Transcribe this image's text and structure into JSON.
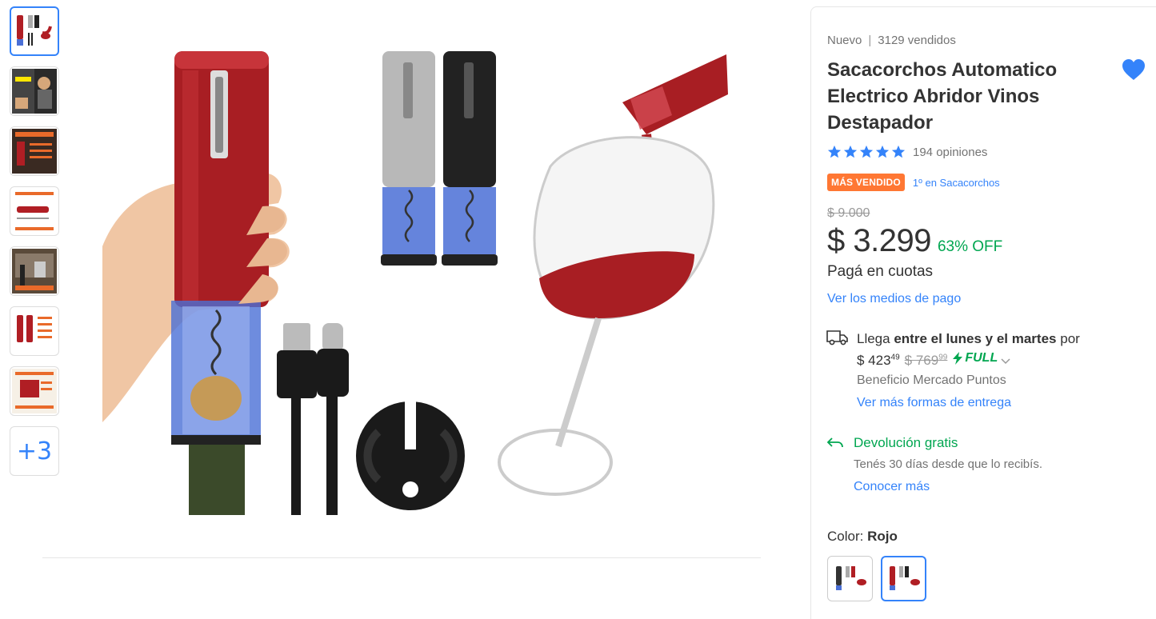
{
  "gallery": {
    "thumbnails": [
      {
        "name": "product-main"
      },
      {
        "name": "flex-video"
      },
      {
        "name": "feature-banner"
      },
      {
        "name": "product-dimensions"
      },
      {
        "name": "usage-scene"
      },
      {
        "name": "product-variants"
      },
      {
        "name": "product-box"
      }
    ],
    "more_label": "+3"
  },
  "product": {
    "condition": "Nuevo",
    "sold": "3129 vendidos",
    "title": "Sacacorchos Automatico Electrico Abridor Vinos Destapador",
    "rating": 5,
    "reviews": "194 opiniones",
    "badge": "MÁS VENDIDO",
    "badge_link": "1º en Sacacorchos",
    "old_price": "$ 9.000",
    "price": "$ 3.299",
    "discount": "63% OFF",
    "installments": "Pagá en cuotas",
    "payment_link": "Ver los medios de pago"
  },
  "shipping": {
    "prefix": "Llega",
    "days": "entre el lunes y el martes",
    "suffix": "por",
    "cost_main": "$ 423",
    "cost_cents": "49",
    "old_cost_main": "$ 769",
    "old_cost_cents": "99",
    "full_label": "FULL",
    "benefit": "Beneficio Mercado Puntos",
    "more_link": "Ver más formas de entrega"
  },
  "returns": {
    "title": "Devolución gratis",
    "description": "Tenés 30 días desde que lo recibís.",
    "link": "Conocer más"
  },
  "color": {
    "label": "Color:",
    "value": "Rojo"
  },
  "colors": {
    "accent": "#3483fa",
    "green": "#00a650",
    "badge": "#ff7733",
    "wine": "#b01e24"
  }
}
